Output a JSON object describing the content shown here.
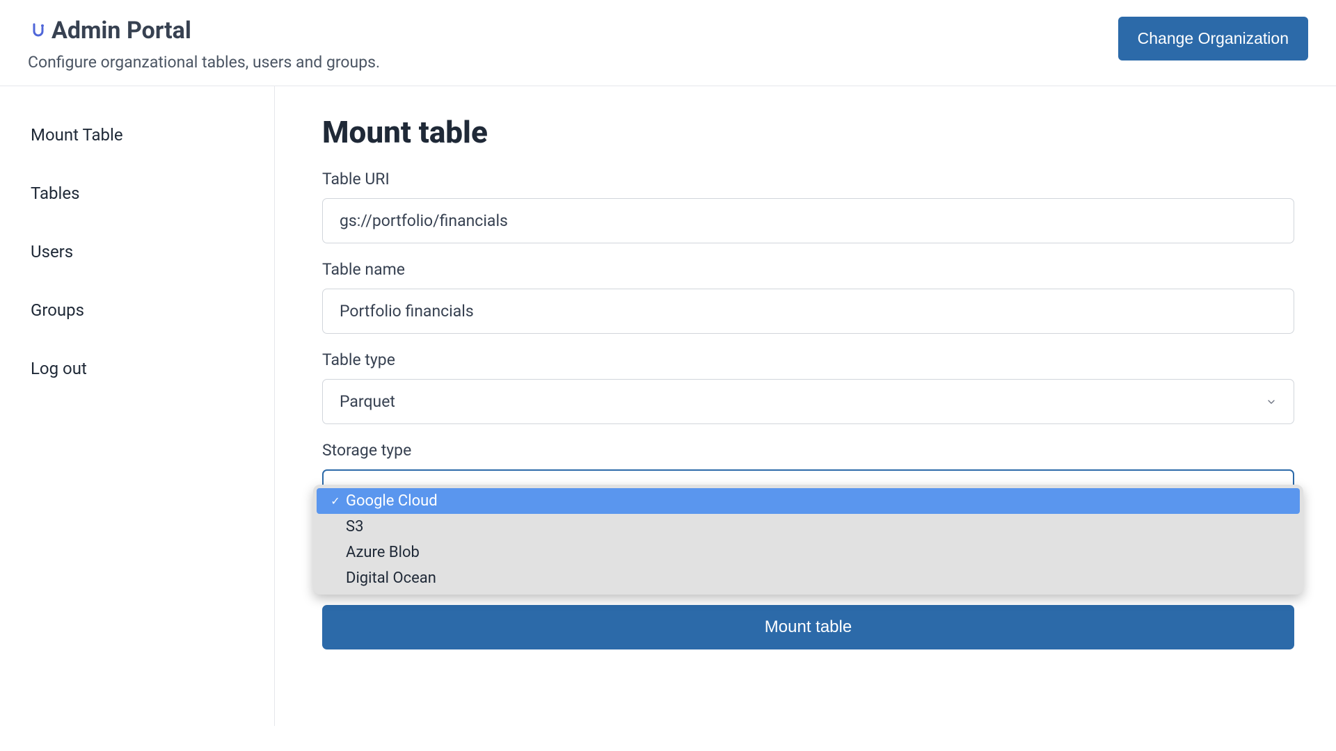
{
  "header": {
    "title": "Admin Portal",
    "subtitle": "Configure organzational tables, users and groups.",
    "change_org_label": "Change Organization"
  },
  "sidebar": {
    "items": [
      {
        "label": "Mount Table"
      },
      {
        "label": "Tables"
      },
      {
        "label": "Users"
      },
      {
        "label": "Groups"
      },
      {
        "label": "Log out"
      }
    ]
  },
  "main": {
    "title": "Mount table",
    "fields": {
      "table_uri": {
        "label": "Table URI",
        "value": "gs://portfolio/financials"
      },
      "table_name": {
        "label": "Table name",
        "value": "Portfolio financials"
      },
      "table_type": {
        "label": "Table type",
        "value": "Parquet"
      },
      "storage_type": {
        "label": "Storage type",
        "options": [
          {
            "label": "Google Cloud",
            "selected": true
          },
          {
            "label": "S3",
            "selected": false
          },
          {
            "label": "Azure Blob",
            "selected": false
          },
          {
            "label": "Digital Ocean",
            "selected": false
          }
        ]
      }
    },
    "submit_label": "Mount table"
  }
}
